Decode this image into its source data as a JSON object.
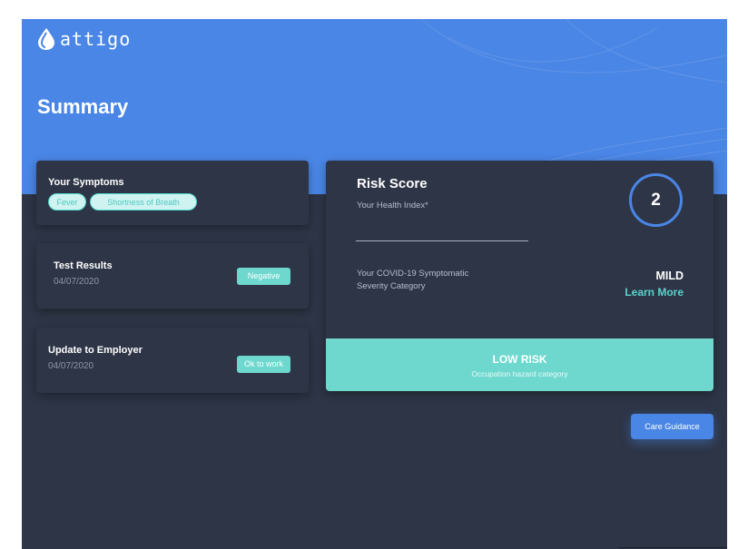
{
  "app": {
    "brand": "attigo"
  },
  "page": {
    "title": "Summary"
  },
  "symptoms": {
    "title": "Your Symptoms",
    "items": [
      "Fever",
      "Shortness of Breath"
    ]
  },
  "test_results": {
    "title": "Test Results",
    "date": "04/07/2020",
    "status": "Negative"
  },
  "employer_update": {
    "title": "Update to Employer",
    "date": "04/07/2020",
    "status": "Ok to work"
  },
  "risk": {
    "title": "Risk Score",
    "subtitle": "Your Health Index*",
    "score": "2",
    "severity_label": "Your  COVID-19 Symptomatic Severity Category",
    "severity_value": "MILD",
    "learn_more": "Learn More",
    "band_title": "LOW RISK",
    "band_subtitle": "Occupation hazard category"
  },
  "actions": {
    "care_guidance": "Care Guidance"
  },
  "colors": {
    "hero_blue": "#4a86e6",
    "background_dark": "#2d3546",
    "card": "#2e3547",
    "teal": "#6ed8cf",
    "teal_text": "#5ad4cb"
  },
  "icons": {
    "logo": "water-drop-icon"
  }
}
